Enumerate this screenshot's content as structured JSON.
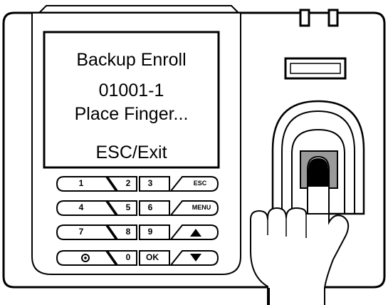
{
  "screen": {
    "title": "Backup Enroll",
    "user_id": "01001-1",
    "prompt": "Place Finger...",
    "exit_hint": "ESC/Exit"
  },
  "keypad": {
    "rows": [
      [
        "1",
        "2",
        "3",
        "ESC"
      ],
      [
        "4",
        "5",
        "6",
        "MENU"
      ],
      [
        "7",
        "8",
        "9",
        "up-arrow"
      ],
      [
        "doorbell",
        "0",
        "OK",
        "down-arrow"
      ]
    ],
    "ok_label": "OK",
    "esc_label": "ESC",
    "menu_label": "MENU"
  },
  "colors": {
    "outline": "#000000",
    "sensor_window": "#9a9a9a",
    "fingertip": "#000000"
  }
}
